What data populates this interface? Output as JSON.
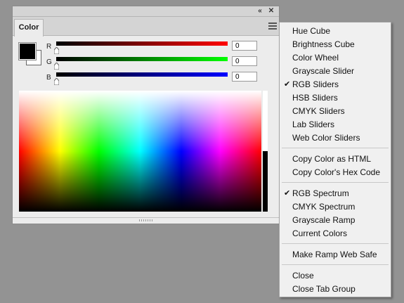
{
  "panel": {
    "tab_label": "Color",
    "collapse_glyph": "«",
    "close_glyph": "✕",
    "foreground_color": "#000000",
    "background_color": "#ffffff",
    "channels": [
      {
        "label": "R",
        "value": "0",
        "gradient_end": "#ff0000",
        "slider_position": 0
      },
      {
        "label": "G",
        "value": "0",
        "gradient_end": "#00ff00",
        "slider_position": 0
      },
      {
        "label": "B",
        "value": "0",
        "gradient_end": "#0000ff",
        "slider_position": 0
      }
    ]
  },
  "menu": {
    "items": [
      {
        "label": "Hue Cube",
        "checked": false
      },
      {
        "label": "Brightness Cube",
        "checked": false
      },
      {
        "label": "Color Wheel",
        "checked": false
      },
      {
        "label": "Grayscale Slider",
        "checked": false
      },
      {
        "label": "RGB Sliders",
        "checked": true
      },
      {
        "label": "HSB Sliders",
        "checked": false
      },
      {
        "label": "CMYK Sliders",
        "checked": false
      },
      {
        "label": "Lab Sliders",
        "checked": false
      },
      {
        "label": "Web Color Sliders",
        "checked": false
      },
      {
        "separator": true
      },
      {
        "label": "Copy Color as HTML",
        "checked": false
      },
      {
        "label": "Copy Color's Hex Code",
        "checked": false
      },
      {
        "separator": true
      },
      {
        "label": "RGB Spectrum",
        "checked": true
      },
      {
        "label": "CMYK Spectrum",
        "checked": false
      },
      {
        "label": "Grayscale Ramp",
        "checked": false
      },
      {
        "label": "Current Colors",
        "checked": false
      },
      {
        "separator": true
      },
      {
        "label": "Make Ramp Web Safe",
        "checked": false
      },
      {
        "separator": true
      },
      {
        "label": "Close",
        "checked": false
      },
      {
        "label": "Close Tab Group",
        "checked": false
      }
    ],
    "check_glyph": "✔"
  }
}
